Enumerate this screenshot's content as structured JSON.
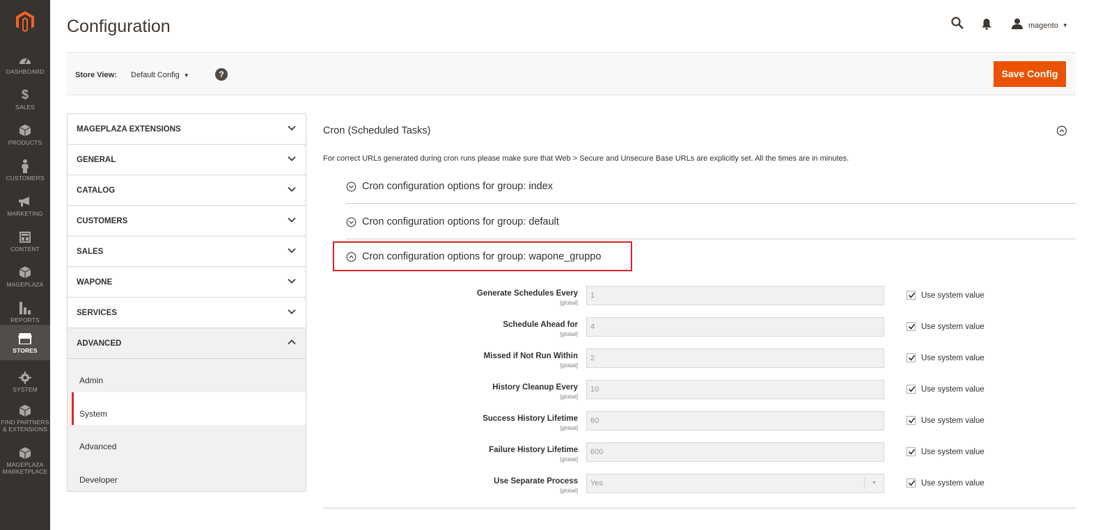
{
  "nav": {
    "logo_icon": "magento-logo-icon",
    "items": [
      {
        "label": "DASHBOARD",
        "icon": "dashboard-icon"
      },
      {
        "label": "SALES",
        "icon": "dollar-icon"
      },
      {
        "label": "PRODUCTS",
        "icon": "cube-icon"
      },
      {
        "label": "CUSTOMERS",
        "icon": "person-icon"
      },
      {
        "label": "MARKETING",
        "icon": "megaphone-icon"
      },
      {
        "label": "CONTENT",
        "icon": "layout-icon"
      },
      {
        "label": "MAGEPLAZA",
        "icon": "cube-icon"
      },
      {
        "label": "REPORTS",
        "icon": "bar-chart-icon"
      },
      {
        "label": "STORES",
        "icon": "store-icon",
        "active": true
      },
      {
        "label": "SYSTEM",
        "icon": "gear-icon"
      },
      {
        "label_line1": "FIND PARTNERS",
        "label_line2": "& EXTENSIONS",
        "icon": "cube-icon"
      },
      {
        "label_line1": "MAGEPLAZA",
        "label_line2": "MARKETPLACE",
        "icon": "cube-icon"
      }
    ]
  },
  "header": {
    "title": "Configuration",
    "username": "magento"
  },
  "scope": {
    "label": "Store View:",
    "value": "Default Config",
    "help": "?",
    "save_label": "Save Config"
  },
  "sidebar": {
    "tabs": [
      {
        "label": "MAGEPLAZA EXTENSIONS"
      },
      {
        "label": "GENERAL"
      },
      {
        "label": "CATALOG"
      },
      {
        "label": "CUSTOMERS"
      },
      {
        "label": "SALES"
      },
      {
        "label": "WAPONE"
      },
      {
        "label": "SERVICES"
      },
      {
        "label": "ADVANCED"
      }
    ],
    "subtabs": [
      {
        "label": "Admin"
      },
      {
        "label": "System"
      },
      {
        "label": "Advanced"
      },
      {
        "label": "Developer"
      }
    ]
  },
  "main": {
    "section_title": "Cron (Scheduled Tasks)",
    "section_note": "For correct URLs generated during cron runs please make sure that Web > Secure and Unsecure Base URLs are explicitly set. All the times are in minutes.",
    "groups": [
      {
        "title": "Cron configuration options for group: index"
      },
      {
        "title": "Cron configuration options for group: default"
      },
      {
        "title": "Cron configuration options for group: wapone_gruppo"
      }
    ],
    "fields": [
      {
        "label": "Generate Schedules Every",
        "scope": "[global]",
        "value": "1",
        "system": "Use system value"
      },
      {
        "label": "Schedule Ahead for",
        "scope": "[global]",
        "value": "4",
        "system": "Use system value"
      },
      {
        "label": "Missed if Not Run Within",
        "scope": "[global]",
        "value": "2",
        "system": "Use system value"
      },
      {
        "label": "History Cleanup Every",
        "scope": "[global]",
        "value": "10",
        "system": "Use system value"
      },
      {
        "label": "Success History Lifetime",
        "scope": "[global]",
        "value": "60",
        "system": "Use system value"
      },
      {
        "label": "Failure History Lifetime",
        "scope": "[global]",
        "value": "600",
        "system": "Use system value"
      },
      {
        "label": "Use Separate Process",
        "scope": "[global]",
        "value": "Yes",
        "system": "Use system value"
      }
    ]
  },
  "colors": {
    "nav_bg": "#373330",
    "accent": "#eb5202",
    "highlight": "#e02020"
  }
}
